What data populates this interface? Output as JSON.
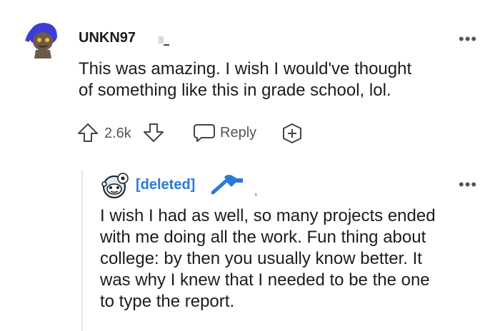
{
  "comments": [
    {
      "username": "UNKN97",
      "text_lines": [
        "This was amazing. I wish I would've thought",
        "of something like this in grade school, lol."
      ],
      "votes": "2.6k",
      "reply_label": "Reply"
    },
    {
      "username": "[deleted]",
      "text_lines": [
        "I wish I had as well, so many projects ended",
        "with me doing all the work. Fun thing about",
        "college: by then you usually know better. It",
        "was why I knew that I needed to be the one",
        "to type the report."
      ]
    }
  ],
  "more_label": "•••",
  "colors": {
    "accent": "#2a79d8",
    "avatar_purple": "#3b3dd6"
  }
}
